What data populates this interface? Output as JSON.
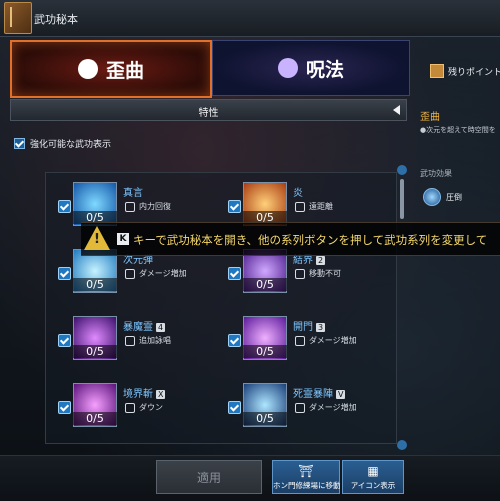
{
  "window": {
    "title": "武功秘本"
  },
  "tabs": [
    {
      "label": "歪曲",
      "active": true
    },
    {
      "label": "呪法",
      "active": false
    }
  ],
  "points": {
    "label": "残りポイント"
  },
  "filter": {
    "label": "特性"
  },
  "show_enhanceable": {
    "label": "強化可能な武功表示",
    "checked": true
  },
  "skills": [
    {
      "name": "真言",
      "badge": "",
      "count": "0/5",
      "effect": "内力回復",
      "icon": "spiral-aura-icon"
    },
    {
      "name": "炎",
      "badge": "",
      "count": "0/5",
      "effect": "遠距離",
      "icon": "flame-icon"
    },
    {
      "name": "次元弾",
      "badge": "",
      "count": "0/5",
      "effect": "ダメージ増加",
      "icon": "dimension-orb-icon"
    },
    {
      "name": "結界",
      "badge": "2",
      "count": "0/5",
      "effect": "移動不可",
      "icon": "barrier-icon"
    },
    {
      "name": "暴魔霊",
      "badge": "4",
      "count": "0/5",
      "effect": "追加詠唱",
      "icon": "demon-spirit-icon"
    },
    {
      "name": "開門",
      "badge": "3",
      "count": "0/5",
      "effect": "ダメージ増加",
      "icon": "open-gate-icon"
    },
    {
      "name": "境界斬",
      "badge": "X",
      "count": "0/5",
      "effect": "ダウン",
      "icon": "boundary-slash-icon"
    },
    {
      "name": "死霊暴陣",
      "badge": "V",
      "count": "0/5",
      "effect": "ダメージ増加",
      "icon": "death-formation-icon"
    }
  ],
  "tooltip": {
    "key": "K",
    "text": "キーで武功秘本を開き、他の系列ボタンを押して武功系列を変更して"
  },
  "right_panel": {
    "title": "歪曲",
    "desc": "●次元を超えて時空間を",
    "effect_label": "武功効果",
    "effect_name": "圧倒"
  },
  "buttons": {
    "apply": "適用",
    "move": "ホン門修練場に移動",
    "icon_view": "アイコン表示"
  },
  "colors": {
    "accent_orange": "#e0702a",
    "skill_name": "#7fc6ff",
    "tooltip_text": "#f4d76a",
    "highlight": "#f2b640"
  }
}
